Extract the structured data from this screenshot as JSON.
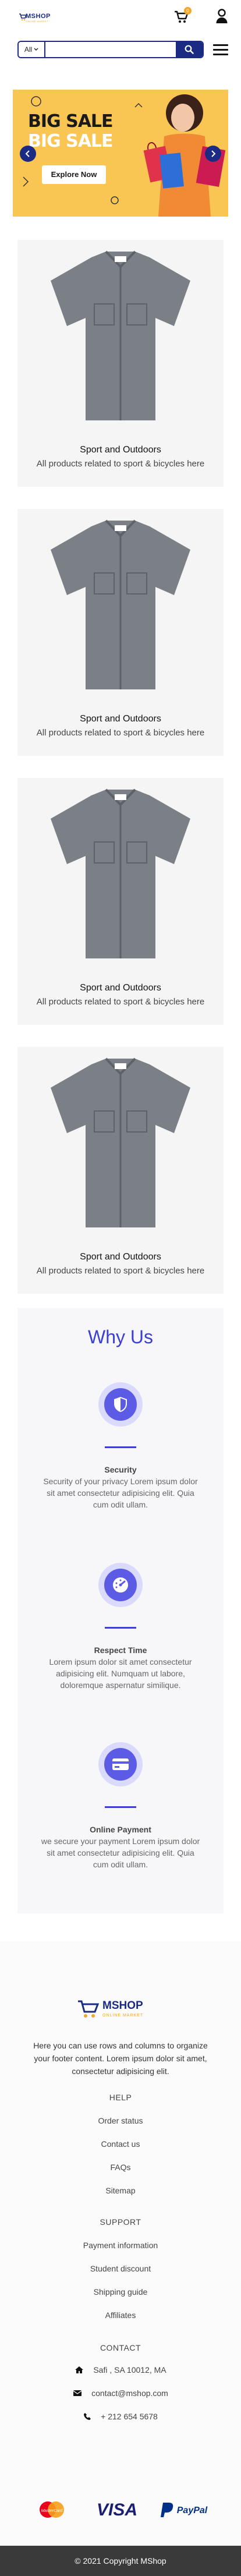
{
  "header": {
    "logo_text": "MSHOP",
    "logo_sub": "ONLINE MARKET",
    "cart_count": "0"
  },
  "search": {
    "category": "All",
    "placeholder": ""
  },
  "banner": {
    "title": "BIG SALE",
    "subtitle": "BIG SALE",
    "button": "Explore Now"
  },
  "products": [
    {
      "title": "Sport and Outdoors",
      "desc": "All products related to sport & bicycles here"
    },
    {
      "title": "Sport and Outdoors",
      "desc": "All products related to sport & bicycles here"
    },
    {
      "title": "Sport and Outdoors",
      "desc": "All products related to sport & bicycles here"
    },
    {
      "title": "Sport and Outdoors",
      "desc": "All products related to sport & bicycles here"
    }
  ],
  "why": {
    "title": "Why Us",
    "features": [
      {
        "icon": "shield-icon",
        "title": "Security",
        "text": "Security of your privacy Lorem ipsum dolor sit amet consectetur adipisicing elit. Quia cum odit ullam."
      },
      {
        "icon": "speedometer-icon",
        "title": "Respect Time",
        "text": "Lorem ipsum dolor sit amet consectetur adipisicing elit. Numquam ut labore, doloremque aspernatur similique."
      },
      {
        "icon": "credit-card-icon",
        "title": "Online Payment",
        "text": "we secure your payment Lorem ipsum dolor sit amet consectetur adipisicing elit. Quia cum odit ullam."
      }
    ]
  },
  "footer": {
    "logo_text": "MSHOP",
    "logo_sub": "ONLINE MARKET",
    "description": "Here you can use rows and columns to organize your footer content. Lorem ipsum dolor sit amet, consectetur adipisicing elit.",
    "help": {
      "title": "HELP",
      "links": [
        "Order status",
        "Contact us",
        "FAQs",
        "Sitemap"
      ]
    },
    "support": {
      "title": "SUPPORT",
      "links": [
        "Payment information",
        "Student discount",
        "Shipping guide",
        "Affiliates"
      ]
    },
    "contact": {
      "title": "CONTACT",
      "address": "Safi , SA 10012, MA",
      "email": "contact@mshop.com",
      "phone": "+ 212 654 5678"
    }
  },
  "payments": [
    "MasterCard",
    "VISA",
    "PayPal"
  ],
  "copyright": "© 2021 Copyright MShop",
  "colors": {
    "brand": "#1b2b84",
    "accent": "#3b3fd1",
    "banner": "#f9c654"
  }
}
